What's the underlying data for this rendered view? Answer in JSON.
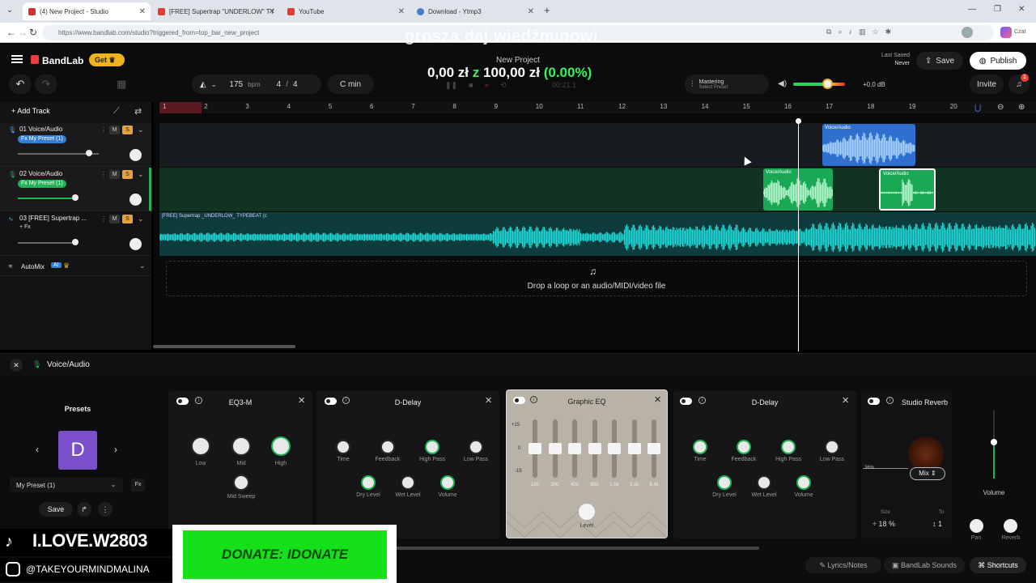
{
  "browser": {
    "tabs": [
      {
        "label": "(4) New Project - Studio",
        "color": "#d32f2f"
      },
      {
        "label": "[FREE] Supertrap \"UNDERLOW\" TY",
        "color": "#e53935"
      },
      {
        "label": "YouTube",
        "color": "#e53935"
      },
      {
        "label": "Download - Ytmp3",
        "color": "#4a7bd0"
      }
    ],
    "new_tab": "+",
    "url": "https://www.bandlab.com/studio?triggered_from=top_bar_new_project",
    "profile": "Czat"
  },
  "watermark": "grosza daj wiedźminowi",
  "header": {
    "logo": "BandLab",
    "get_label": "Get",
    "project_title": "New Project",
    "donation_text": "0,00 zł",
    "donation_z": "z",
    "donation_goal": "100,00 zł",
    "donation_pct": "(0.00%)",
    "time": "00:21.1",
    "tempo": "175",
    "tempo_unit": "bpm",
    "signature_num": "4",
    "signature_sep": "/",
    "signature_den": "4",
    "key": "C min",
    "mastering_label": "Mastering",
    "mastering_sub": "Select Preset",
    "volume_db": "+0.0 dB",
    "last_saved_label": "Last Saved",
    "last_saved_value": "Never",
    "save": "Save",
    "publish": "Publish",
    "invite": "Invite",
    "notif_count": "1"
  },
  "tracks": {
    "add_track": "Add Track",
    "items": [
      {
        "label": "01  Voice/Audio",
        "preset": "Fx My Preset (1)",
        "preset_color": "#2f7fd8",
        "m": "M",
        "s": "S"
      },
      {
        "label": "02  Voice/Audio",
        "preset": "Fx My Preset (1)",
        "preset_color": "#1db454",
        "m": "M",
        "s": "S"
      },
      {
        "label": "03  [FREE] Supertrap ...",
        "preset": "+ Fx",
        "preset_color": "",
        "m": "M",
        "s": "S"
      }
    ],
    "automix": "AutoMix",
    "ai": "AI"
  },
  "ruler": [
    "1",
    "2",
    "3",
    "4",
    "5",
    "6",
    "7",
    "8",
    "9",
    "10",
    "11",
    "12",
    "13",
    "14",
    "15",
    "16",
    "17",
    "18",
    "19",
    "20"
  ],
  "clips": {
    "voice": "Voice/Audio",
    "beat": "[FREE] Supertrap _UNDERLOW_ TYPEBEAT (c"
  },
  "drop_text": "Drop a loop or an audio/MIDI/video file",
  "panel": {
    "title": "Voice/Audio",
    "presets_label": "Presets",
    "preset_letter": "D",
    "preset_name": "My Preset (1)",
    "fx": "Fx",
    "save": "Save",
    "effects": [
      {
        "name": "EQ3-M",
        "knobs": [
          "Low",
          "Mid",
          "High",
          "Mid Sweep"
        ]
      },
      {
        "name": "D-Delay",
        "knobs": [
          "Time",
          "Feedback",
          "High Pass",
          "Low Pass",
          "Dry Level",
          "Wet Level",
          "Volume"
        ]
      },
      {
        "name": "Graphic EQ",
        "bands": [
          "100",
          "200",
          "400",
          "800",
          "1.6k",
          "3.2k",
          "6.4k"
        ],
        "scale": [
          "+15",
          "0",
          "-15"
        ],
        "level": "Level"
      },
      {
        "name": "D-Delay",
        "knobs": [
          "Time",
          "Feedback",
          "High Pass",
          "Low Pass",
          "Dry Level",
          "Wet Level",
          "Volume"
        ]
      },
      {
        "name": "Studio Reverb",
        "mix": "Mix",
        "pct": "36%",
        "size_label": "Size",
        "size_val": "18 %",
        "to_label": "To",
        "to_val": "1"
      }
    ],
    "volume": "Volume",
    "pan": "Pan",
    "reverb": "Reverb"
  },
  "footer": {
    "lyrics": "Lyrics/Notes",
    "sounds": "BandLab Sounds",
    "shortcuts": "Shortcuts"
  },
  "overlay": {
    "tiktok": "I.LOVE.W2803",
    "insta": "@TAKEYOURMINDMALINA",
    "donate": "DONATE: IDONATE"
  }
}
